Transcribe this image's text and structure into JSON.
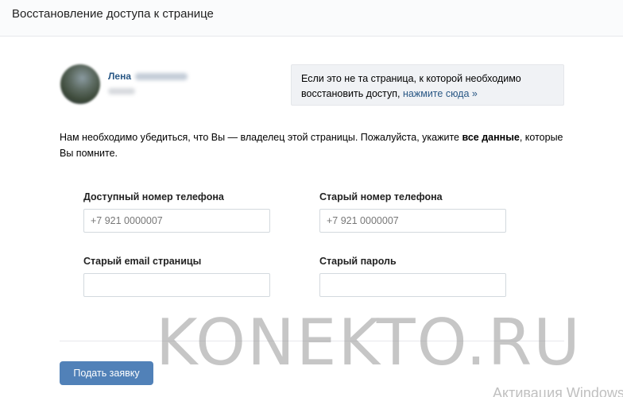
{
  "header": {
    "title": "Восстановление доступа к странице"
  },
  "user": {
    "first_name": "Лена"
  },
  "info_box": {
    "text": "Если это не та страница, к которой необходимо восстановить доступ,",
    "link": "нажмите сюда »"
  },
  "description": {
    "text_before": "Нам необходимо убедиться, что Вы — владелец этой страницы. Пожалуйста, укажите ",
    "bold": "все данные",
    "text_after": ", которые Вы помните."
  },
  "form": {
    "available_phone": {
      "label": "Доступный номер телефона",
      "placeholder": "+7 921 0000007",
      "value": ""
    },
    "old_phone": {
      "label": "Старый номер телефона",
      "placeholder": "+7 921 0000007",
      "value": ""
    },
    "old_email": {
      "label": "Старый email страницы",
      "placeholder": "",
      "value": ""
    },
    "old_password": {
      "label": "Старый пароль",
      "placeholder": "",
      "value": ""
    }
  },
  "submit_label": "Подать заявку",
  "watermark": "KONEKTO.RU",
  "windows_activation": "Активация Windows",
  "colors": {
    "link": "#2a5885",
    "button": "#5181b8",
    "header_bg": "#fafbfc",
    "info_bg": "#f0f2f5"
  }
}
